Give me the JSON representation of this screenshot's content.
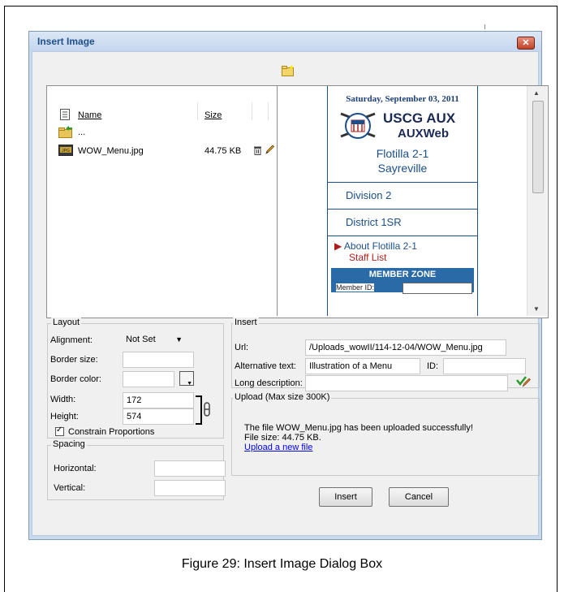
{
  "dialog": {
    "title": "Insert Image",
    "close_label": "✕"
  },
  "filelist": {
    "headers": {
      "name": "Name",
      "size": "Size"
    },
    "parent": "...",
    "files": [
      {
        "name": "WOW_Menu.jpg",
        "size": "44.75 KB"
      }
    ]
  },
  "preview": {
    "date": "Saturday, September 03, 2011",
    "logo_line1": "USCG AUX",
    "logo_line2": "AUXWeb",
    "flotilla": "Flotilla 2-1",
    "city": "Sayreville",
    "nav": [
      "Division 2",
      "District 1SR"
    ],
    "about": "About Flotilla 2-1",
    "staff": "Staff List",
    "zone": "MEMBER ZONE",
    "member_id": "Member ID:"
  },
  "layout": {
    "legend": "Layout",
    "alignment_label": "Alignment:",
    "alignment_value": "Not Set",
    "border_size_label": "Border size:",
    "border_color_label": "Border color:",
    "width_label": "Width:",
    "width_value": "172",
    "height_label": "Height:",
    "height_value": "574",
    "constrain_label": "Constrain Proportions"
  },
  "spacing": {
    "legend": "Spacing",
    "horizontal_label": "Horizontal:",
    "vertical_label": "Vertical:"
  },
  "insert": {
    "legend": "Insert",
    "url_label": "Url:",
    "url_value": "/Uploads_wowII/114-12-04/WOW_Menu.jpg",
    "alt_label": "Alternative text:",
    "alt_value": "Illustration of a Menu",
    "id_label": "ID:",
    "long_desc_label": "Long description:"
  },
  "upload": {
    "legend": "Upload (Max size 300K)",
    "message": "The file WOW_Menu.jpg has been uploaded successfully!",
    "file_size": "File size: 44.75 KB.",
    "link": "Upload a new file"
  },
  "buttons": {
    "insert": "Insert",
    "cancel": "Cancel"
  },
  "caption": "Figure 29: Insert Image Dialog Box",
  "colors": {
    "accent": "#1c4f8a",
    "link": "#0000ee",
    "nav_red": "#b01c1c"
  }
}
